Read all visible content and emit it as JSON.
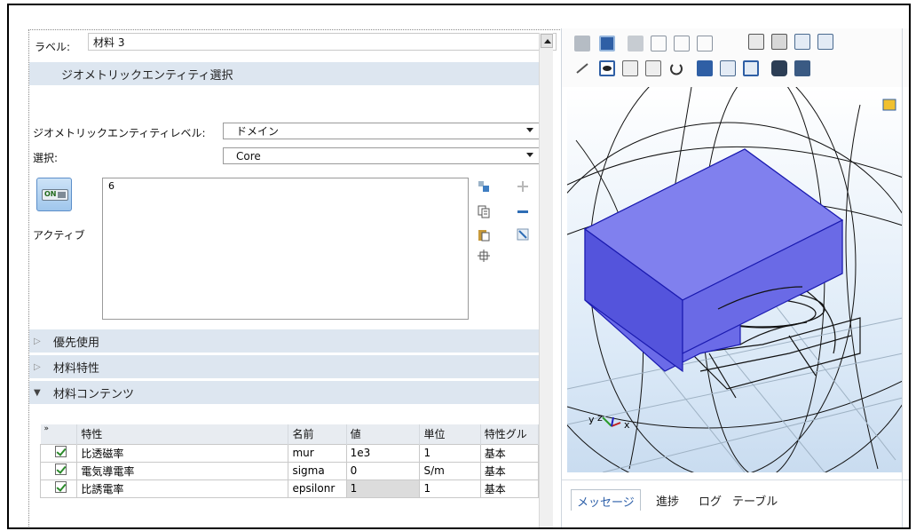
{
  "settings": {
    "label_caption": "ラベル:",
    "label_value": "材料 3",
    "geom_section_title": "ジオメトリックエンティティ選択",
    "level_caption": "ジオメトリックエンティティレベル:",
    "level_value": "ドメイン",
    "selection_caption": "選択:",
    "selection_value": "Core",
    "list_items": [
      "6"
    ],
    "active_label": "アクティブ",
    "toggle_text": "ON"
  },
  "sections": [
    {
      "title": "優先使用",
      "expanded": false
    },
    {
      "title": "材料特性",
      "expanded": false
    },
    {
      "title": "材料コンテンツ",
      "expanded": true
    }
  ],
  "table": {
    "header_marker": "»",
    "columns": [
      "特性",
      "名前",
      "値",
      "単位",
      "特性グル"
    ],
    "rows": [
      {
        "checked": true,
        "property": "比透磁率",
        "name": "mur",
        "value": "1e3",
        "unit": "1",
        "group": "基本"
      },
      {
        "checked": true,
        "property": "電気導電率",
        "name": "sigma",
        "value": "0",
        "unit": "S/m",
        "group": "基本"
      },
      {
        "checked": true,
        "property": "比誘電率",
        "name": "epsilonr",
        "value": "1",
        "unit": "1",
        "group": "基本"
      }
    ]
  },
  "graphics": {
    "axis_labels": [
      "y",
      "z",
      "x"
    ],
    "highlight_color": "#5a5af0"
  },
  "bottom_tabs": [
    "メッセージ",
    "進捗",
    "ログ",
    "テーブル"
  ]
}
